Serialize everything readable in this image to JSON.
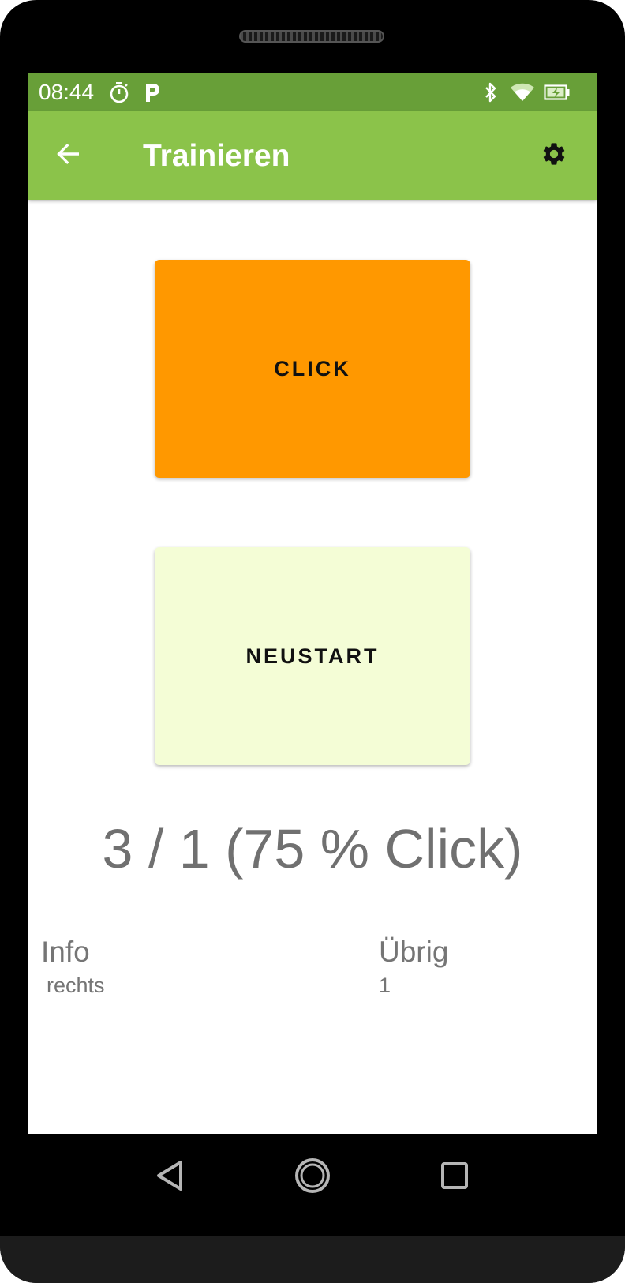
{
  "status_bar": {
    "time": "08:44",
    "background_color": "#689f38",
    "icons": [
      "timer-icon",
      "parking-icon",
      "bluetooth-icon",
      "wifi-icon",
      "battery-icon"
    ]
  },
  "app_bar": {
    "title": "Trainieren",
    "background_color": "#8bc34a",
    "back_icon": "arrow-back-icon",
    "settings_icon": "gear-icon"
  },
  "buttons": {
    "click_label": "CLICK",
    "click_color": "#ff9800",
    "restart_label": "NEUSTART",
    "restart_color": "#f4fdd6"
  },
  "stats": {
    "score": "3 / 1 (75 % Click)",
    "info_label": "Info",
    "info_value": "rechts",
    "remaining_label": "Übrig",
    "remaining_value": "1"
  },
  "nav_bar": {
    "icons": [
      "back-triangle-icon",
      "home-circle-icon",
      "recents-square-icon"
    ]
  }
}
